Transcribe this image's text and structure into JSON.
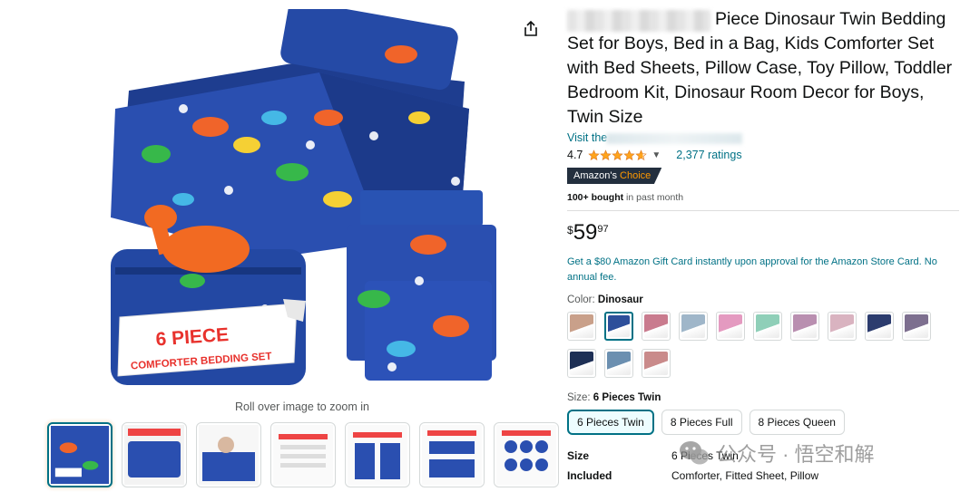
{
  "product": {
    "title": "Piece Dinosaur Twin Bedding Set for Boys, Bed in a Bag, Kids Comforter Set with Bed Sheets, Pillow Case, Toy Pillow, Toddler Bedroom Kit, Dinosaur Room Decor for Boys, Twin Size",
    "visit_store_prefix": "Visit the",
    "rating_value": "4.7",
    "rating_stars": 4.7,
    "ratings_count": "2,377 ratings",
    "badge": {
      "prefix": "Amazon's",
      "highlight": "Choice"
    },
    "bought": {
      "bold": "100+ bought",
      "rest": " in past month"
    },
    "price": {
      "symbol": "$",
      "whole": "59",
      "fraction": "97"
    },
    "offer_text": "Get a $80 Amazon Gift Card instantly upon approval for the Amazon Store Card. No annual fee."
  },
  "media": {
    "zoom_hint": "Roll over image to zoom in",
    "image_banner_line1": "6 PIECE",
    "image_banner_line2": "COMFORTER BEDDING SET",
    "thumbnail_count": 7,
    "selected_thumbnail": 0
  },
  "color": {
    "label": "Color:",
    "selected": "Dinosaur",
    "swatch_colors": [
      "#c9a08a",
      "#2d4f9a",
      "#c97b8e",
      "#9fb6c9",
      "#e49ac0",
      "#8fcfb8",
      "#b98fb0",
      "#d9b3c0",
      "#2c3c6e",
      "#7d6f8f",
      "#1d2f55",
      "#6b8fb0",
      "#c98a8a"
    ],
    "selected_index": 1
  },
  "size": {
    "label": "Size:",
    "selected": "6 Pieces Twin",
    "options": [
      "6 Pieces Twin",
      "8 Pieces Full",
      "8 Pieces Queen"
    ],
    "selected_index": 0
  },
  "specs": [
    {
      "key": "Size",
      "value": "6 Pieces Twin"
    },
    {
      "key": "Included",
      "value": "Comforter, Fitted Sheet, Pillow"
    }
  ],
  "watermark": {
    "text": "公众号 · 悟空和解"
  },
  "colors": {
    "link": "#007185",
    "badge_bg": "#232F3E",
    "badge_accent": "#FF9900",
    "star": "#FFA41C",
    "selected_border": "#007185"
  }
}
